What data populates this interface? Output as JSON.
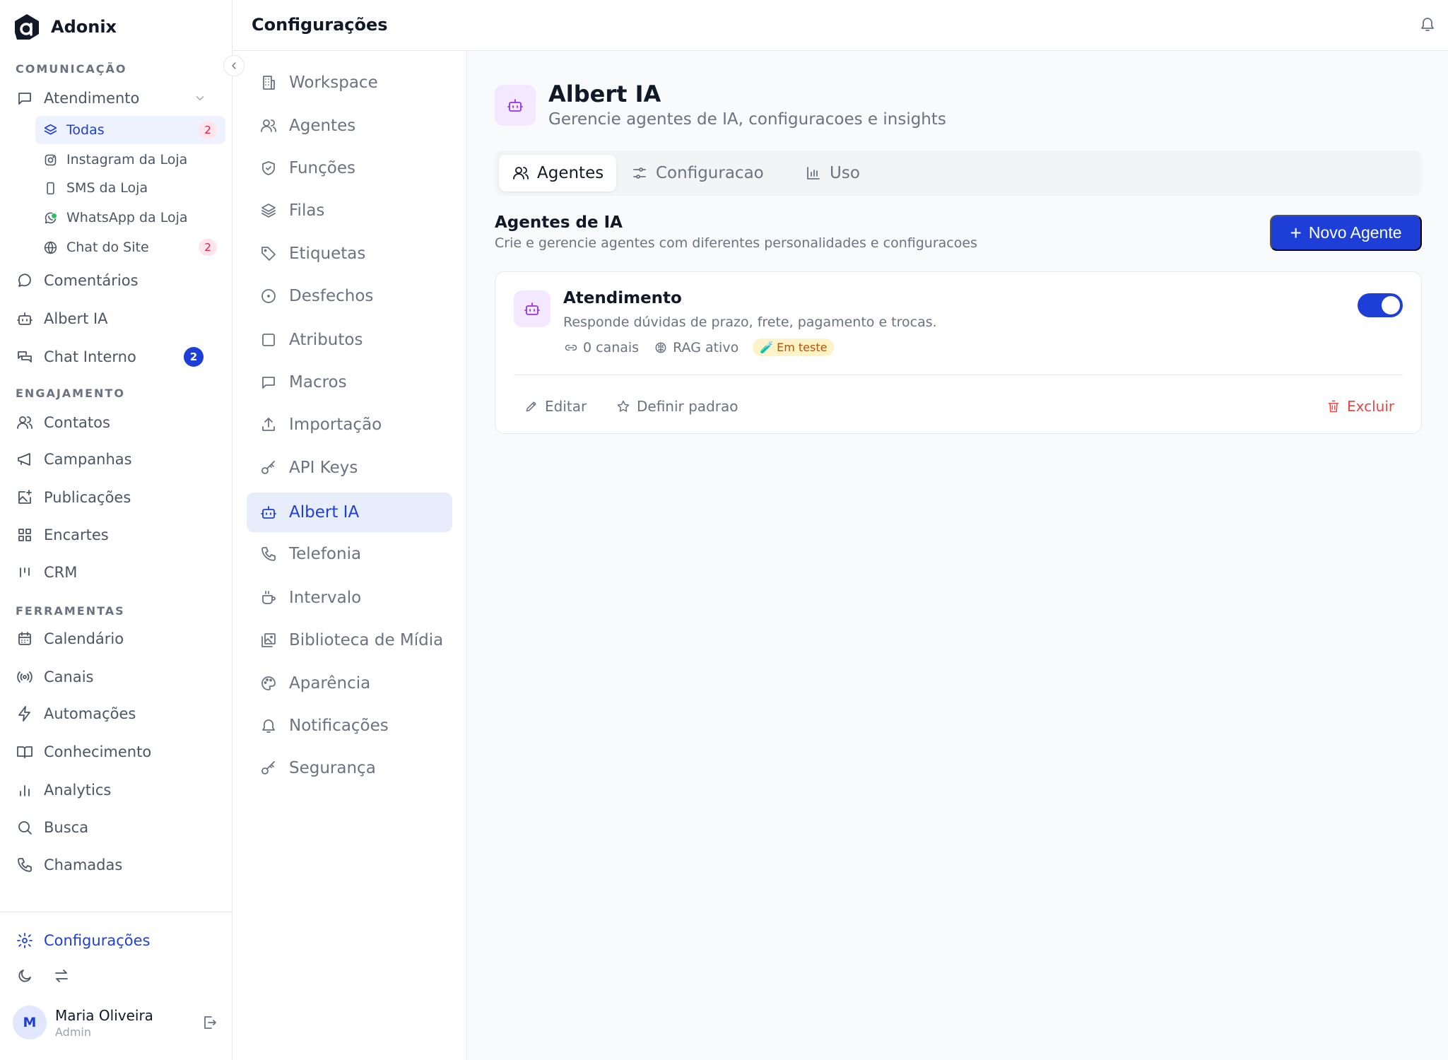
{
  "brand": {
    "name": "Adonix"
  },
  "sidebar": {
    "sections": {
      "comunicacao": "COMUNICAÇÃO",
      "engajamento": "ENGAJAMENTO",
      "ferramentas": "FERRAMENTAS"
    },
    "atendimento": {
      "label": "Atendimento",
      "expanded": true,
      "children": [
        {
          "label": "Todas",
          "icon": "layers-icon",
          "badge": "2",
          "active": true
        },
        {
          "label": "Instagram da Loja",
          "icon": "instagram-icon",
          "badge": null
        },
        {
          "label": "SMS da Loja",
          "icon": "smartphone-icon",
          "badge": null
        },
        {
          "label": "WhatsApp da Loja",
          "icon": "whatsapp-icon",
          "badge": null,
          "status": "online"
        },
        {
          "label": "Chat do Site",
          "icon": "globe-icon",
          "badge": "2"
        }
      ]
    },
    "comunicacao_items": [
      {
        "label": "Comentários",
        "icon": "comment-icon"
      },
      {
        "label": "Albert IA",
        "icon": "bot-icon"
      },
      {
        "label": "Chat Interno",
        "icon": "chat-icon",
        "badge": "2"
      }
    ],
    "engajamento_items": [
      {
        "label": "Contatos",
        "icon": "users-icon"
      },
      {
        "label": "Campanhas",
        "icon": "megaphone-icon"
      },
      {
        "label": "Publicações",
        "icon": "image-plus-icon"
      },
      {
        "label": "Encartes",
        "icon": "grid-icon"
      },
      {
        "label": "CRM",
        "icon": "kanban-icon"
      }
    ],
    "ferramentas_items": [
      {
        "label": "Calendário",
        "icon": "calendar-icon"
      },
      {
        "label": "Canais",
        "icon": "radio-icon"
      },
      {
        "label": "Automações",
        "icon": "zap-icon"
      },
      {
        "label": "Conhecimento",
        "icon": "book-icon"
      },
      {
        "label": "Analytics",
        "icon": "bar-chart-icon"
      },
      {
        "label": "Busca",
        "icon": "search-icon"
      },
      {
        "label": "Chamadas",
        "icon": "phone-icon"
      }
    ],
    "settings_label": "Configurações",
    "user": {
      "initial": "M",
      "name": "Maria Oliveira",
      "role": "Admin"
    }
  },
  "header": {
    "title": "Configurações"
  },
  "settings_menu": [
    {
      "label": "Workspace",
      "icon": "building-icon"
    },
    {
      "label": "Agentes",
      "icon": "users-icon"
    },
    {
      "label": "Funções",
      "icon": "shield-check-icon"
    },
    {
      "label": "Filas",
      "icon": "layers-icon"
    },
    {
      "label": "Etiquetas",
      "icon": "tag-icon"
    },
    {
      "label": "Desfechos",
      "icon": "circle-dot-icon"
    },
    {
      "label": "Atributos",
      "icon": "square-icon"
    },
    {
      "label": "Macros",
      "icon": "message-square-icon"
    },
    {
      "label": "Importação",
      "icon": "upload-icon"
    },
    {
      "label": "API Keys",
      "icon": "key-icon"
    },
    {
      "label": "Albert IA",
      "icon": "bot-icon",
      "active": true
    },
    {
      "label": "Telefonia",
      "icon": "phone-icon"
    },
    {
      "label": "Intervalo",
      "icon": "coffee-icon"
    },
    {
      "label": "Biblioteca de Mídia",
      "icon": "images-icon"
    },
    {
      "label": "Aparência",
      "icon": "palette-icon"
    },
    {
      "label": "Notificações",
      "icon": "bell-icon"
    },
    {
      "label": "Segurança",
      "icon": "key-icon"
    }
  ],
  "main": {
    "title": "Albert IA",
    "subtitle": "Gerencie agentes de IA, configuracoes e insights",
    "tabs": [
      {
        "label": "Agentes",
        "icon": "users-icon",
        "active": true
      },
      {
        "label": "Configuracao",
        "icon": "sliders-icon"
      },
      {
        "label": "Uso",
        "icon": "bar-chart-icon"
      }
    ],
    "section_title": "Agentes de IA",
    "section_subtitle": "Crie e gerencie agentes com diferentes personalidades e configuracoes",
    "new_agent_label": "Novo Agente",
    "agent": {
      "name": "Atendimento",
      "description": "Responde dúvidas de prazo, frete, pagamento e trocas.",
      "channels": "0 canais",
      "rag": "RAG ativo",
      "status": "Em teste",
      "enabled": true,
      "actions": {
        "edit": "Editar",
        "default": "Definir padrao",
        "delete": "Excluir"
      }
    }
  },
  "colors": {
    "accent": "#1d3fd8",
    "ai_purple": "#9333ea",
    "danger": "#ef4444",
    "badge_pink": "#e11d48"
  }
}
